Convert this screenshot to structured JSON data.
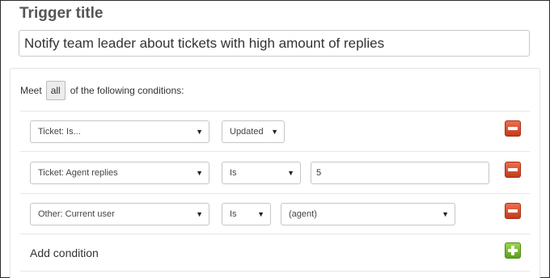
{
  "trigger": {
    "heading": "Trigger title",
    "title_value": "Notify team leader about tickets with high amount of replies"
  },
  "conditions": {
    "meet_prefix": "Meet",
    "meet_mode": "all",
    "meet_suffix": "of the following conditions:",
    "rows": [
      {
        "field": "Ticket: Is...",
        "operator": "Updated",
        "value": ""
      },
      {
        "field": "Ticket: Agent replies",
        "operator": "Is",
        "value": "5"
      },
      {
        "field": "Other: Current user",
        "operator": "Is",
        "value": "(agent)"
      }
    ],
    "add_label": "Add condition"
  },
  "icons": {
    "remove": "minus-icon",
    "add": "plus-icon",
    "dropdown": "chevron-down-icon"
  },
  "colors": {
    "remove_button": "#d9472a",
    "add_button": "#7cc233"
  }
}
